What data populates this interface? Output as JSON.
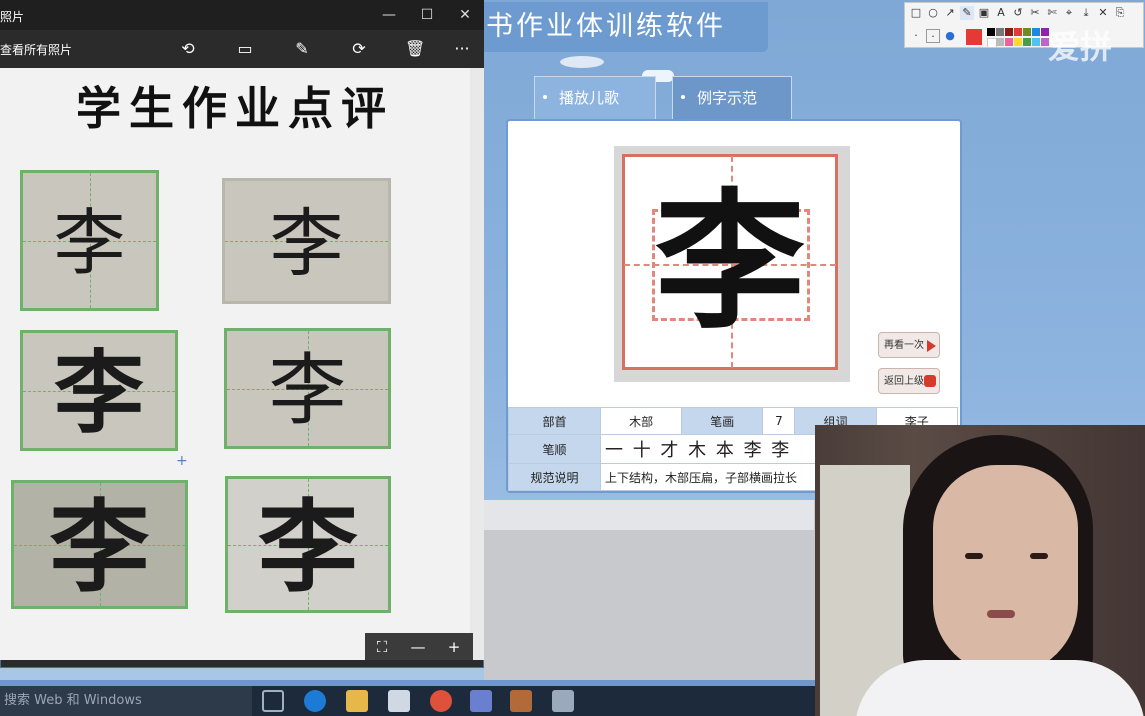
{
  "software": {
    "title": "书作业体训练软件",
    "tabs": [
      {
        "label": "播放儿歌"
      },
      {
        "label": "例字示范"
      }
    ],
    "sample_character": "李",
    "buttons": {
      "again": "再看一次",
      "back": "返回上级"
    },
    "info": {
      "radical_label": "部首",
      "radical_value": "木部",
      "strokes_label": "笔画",
      "strokes_value": "7",
      "words_label": "组词",
      "words_value": "李子",
      "order_label": "笔顺",
      "order_value": "一 十 才 木 本 李 李",
      "note_label": "规范说明",
      "note_value": "上下结构，木部压扁，子部横画拉长"
    },
    "watermark": "爱拼"
  },
  "photos_app": {
    "window_title": "照片",
    "see_all": "查看所有照片",
    "controls": {
      "minimize": "—",
      "maximize": "☐",
      "close": "✕"
    },
    "toolbar_more": "···",
    "heading": "学生作业点评",
    "homework_character": "李",
    "zoom": {
      "minus": "—",
      "plus": "+"
    }
  },
  "taskbar": {
    "search_text": "搜索 Web 和 Windows"
  },
  "colors": {
    "accent": "#6e9bcf",
    "grid_red": "#d7715f",
    "green_grid": "#6fb16a",
    "anno_red": "#e53935"
  }
}
